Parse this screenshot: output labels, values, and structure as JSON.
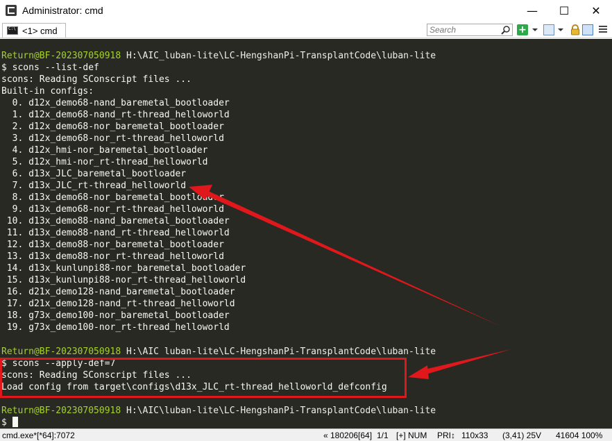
{
  "window": {
    "title": "Administrator: cmd",
    "minimize_glyph": "—",
    "maximize_glyph": "☐",
    "close_glyph": "✕"
  },
  "toolbar": {
    "tab_label": "<1> cmd",
    "search_placeholder": "Search",
    "add_glyph": "+",
    "icons": [
      "search-icon",
      "add-console-icon",
      "view-icon",
      "lock-icon",
      "panel-icon",
      "menu-icon"
    ]
  },
  "console": {
    "background": "#282923",
    "prompt_color": "#a6d32a",
    "prompt1": {
      "user": "Return@BF-202307050918",
      "path": " H:\\AIC_luban-lite\\LC-HengshanPi-TransplantCode\\luban-lite"
    },
    "cmd1": "$ scons --list-def",
    "out1": "scons: Reading SConscript files ...",
    "out2": "Built-in configs:",
    "configs": [
      "  0. d12x_demo68-nand_baremetal_bootloader",
      "  1. d12x_demo68-nand_rt-thread_helloworld",
      "  2. d12x_demo68-nor_baremetal_bootloader",
      "  3. d12x_demo68-nor_rt-thread_helloworld",
      "  4. d12x_hmi-nor_baremetal_bootloader",
      "  5. d12x_hmi-nor_rt-thread_helloworld",
      "  6. d13x_JLC_baremetal_bootloader",
      "  7. d13x_JLC_rt-thread_helloworld",
      "  8. d13x_demo68-nor_baremetal_bootloader",
      "  9. d13x_demo68-nor_rt-thread_helloworld",
      " 10. d13x_demo88-nand_baremetal_bootloader",
      " 11. d13x_demo88-nand_rt-thread_helloworld",
      " 12. d13x_demo88-nor_baremetal_bootloader",
      " 13. d13x_demo88-nor_rt-thread_helloworld",
      " 14. d13x_kunlunpi88-nor_baremetal_bootloader",
      " 15. d13x_kunlunpi88-nor_rt-thread_helloworld",
      " 16. d21x_demo128-nand_baremetal_bootloader",
      " 17. d21x_demo128-nand_rt-thread_helloworld",
      " 18. g73x_demo100-nor_baremetal_bootloader",
      " 19. g73x_demo100-nor_rt-thread_helloworld"
    ],
    "prompt2": {
      "user": "Return@BF-202307050918",
      "path": " H:\\AIC luban-lite\\LC-HengshanPi-TransplantCode\\luban-lite"
    },
    "cmd2": "$ scons --apply-def=7",
    "out3": "scons: Reading SConscript files ...",
    "out4": "Load config from target\\configs\\d13x_JLC_rt-thread_helloworld_defconfig",
    "prompt3": {
      "user": "Return@BF-202307050918",
      "path": " H:\\AIC\\luban-lite\\LC-HengshanPi-TransplantCode\\luban-lite"
    },
    "cmd3": "$ ",
    "annotation_color": "#e0181b"
  },
  "statusbar": {
    "process": "cmd.exe*[*64]:7072",
    "pos": "« 180206[64]",
    "pages": "1/1",
    "num": "[+] NUM",
    "pri": "PRI↕",
    "size": "110x33",
    "cursor": "(3,41) 25V",
    "mem": "41604 100%"
  }
}
